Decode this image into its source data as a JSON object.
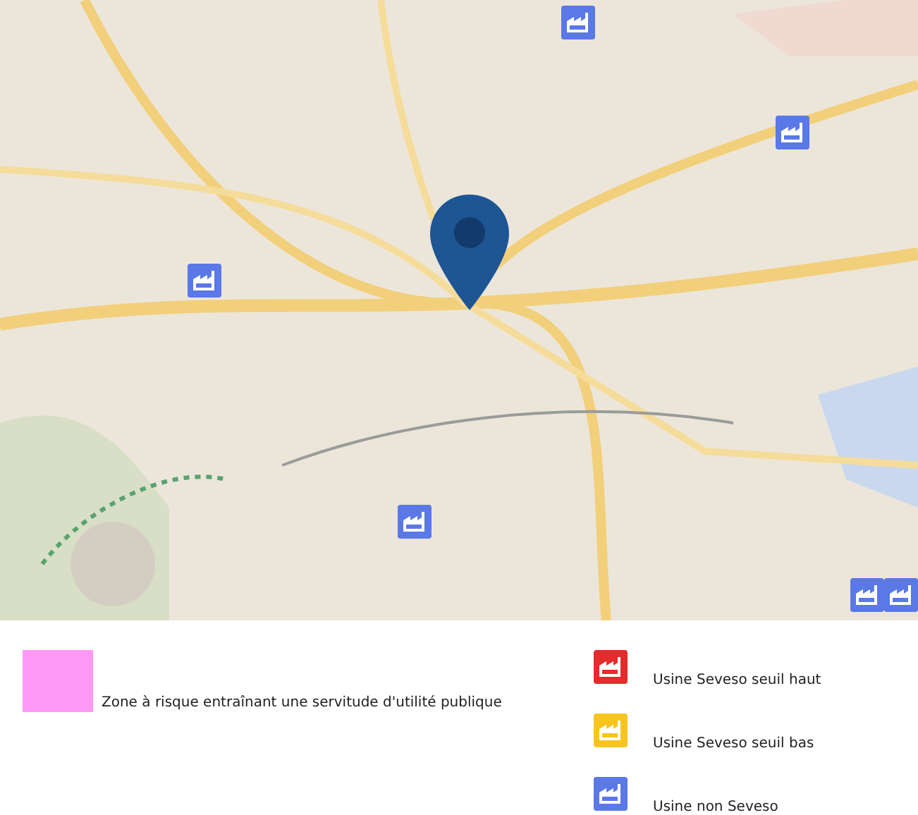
{
  "legend": {
    "zones": [
      {
        "kind": "zone",
        "color": "#ff99f5",
        "label": "Zone à risque entraînant une servitude d'utilité publique"
      }
    ],
    "factories": [
      {
        "kind": "factory",
        "color": "#e52b2b",
        "label": "Usine Seveso seuil haut"
      },
      {
        "kind": "factory",
        "color": "#f7c51e",
        "label": "Usine Seveso seuil bas"
      },
      {
        "kind": "factory",
        "color": "#5a78e6",
        "label": "Usine non Seveso"
      }
    ]
  }
}
